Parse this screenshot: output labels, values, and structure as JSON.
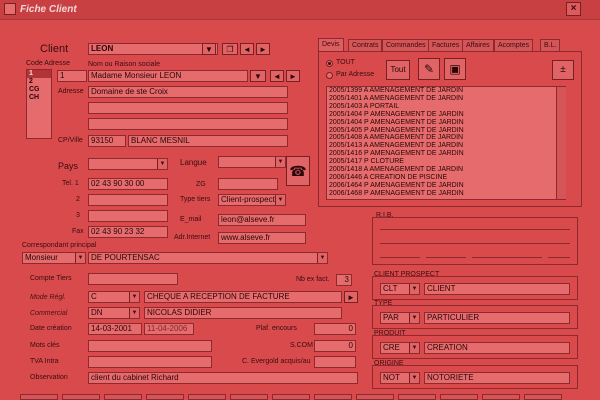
{
  "window": {
    "title": "Fiche Client",
    "close_glyph": "×"
  },
  "client": {
    "label": "Client",
    "code": "LEON",
    "code_adresse_label": "Code Adresse",
    "code_adresse_items": [
      "1",
      "2",
      "CG",
      "CH"
    ],
    "nom_label": "Nom ou Raison sociale",
    "num": "1",
    "nom": "Madame Monsieur LEON",
    "adresse_label": "Adresse",
    "adresse": "Domaine de ste Croix",
    "cp_ville_label": "CP/Ville",
    "cp": "93150",
    "ville": "BLANC MESNIL",
    "pays_label": "Pays",
    "langue_label": "Langue",
    "tel1_label": "Tel. 1",
    "tel1": "02 43 90 30 00",
    "zg_label": "ZG",
    "tel2_label": "2",
    "type_tiers_label": "Type tiers",
    "type_tiers": "Client-prospect",
    "tel3_label": "3",
    "email_label": "E_mail",
    "email": "leon@alseve.fr",
    "fax_label": "Fax",
    "fax": "02 43 90 23 32",
    "adr_internet_label": "Adr.Internet",
    "adr_internet": "www.alseve.fr"
  },
  "buttons": {
    "nav_down": "▼",
    "nav_prev": "◄",
    "nav_next": "►",
    "tout": "Tout",
    "wand": "✎",
    "print": "▣",
    "export": "±"
  },
  "tabs": [
    "Devis",
    "Contrats",
    "Commandes",
    "Factures",
    "Affaires",
    "Acomptes",
    "B.L."
  ],
  "devis": {
    "radio_tout": "TOUT",
    "radio_par_adresse": "Par Adresse",
    "items": [
      "2005/1399 A AMENAGEMENT DE JARDIN",
      "2005/1401 A AMENAGEMENT DE JARDIN",
      "2005/1403 A PORTAIL",
      "2005/1404 P AMENAGEMENT DE JARDIN",
      "2005/1404 P AMENAGEMENT DE JARDIN",
      "2005/1405 P AMENAGEMENT DE JARDIN",
      "2005/1408 A AMENAGEMENT DE JARDIN",
      "2005/1413 A AMENAGEMENT DE JARDIN",
      "2005/1416 P AMENAGEMENT DE JARDIN",
      "2005/1417 P CLOTURE",
      "2005/1418 A AMENAGEMENT DE JARDIN",
      "2006/1446 A CREATION DE PISCINE",
      "2006/1464 P AMENAGEMENT DE JARDIN",
      "2006/1468 P AMENAGEMENT DE JARDIN"
    ]
  },
  "correspondant": {
    "label": "Correspondant principal",
    "civilite": "Monsieur",
    "nom": "DE POURTENSAC"
  },
  "compte": {
    "compte_tiers_label": "Compte Tiers",
    "nb_ex_fact_label": "Nb ex fact.",
    "nb_ex_fact": "3",
    "mode_regl_label": "Mode Régl.",
    "mode_regl_code": "C",
    "mode_regl": "CHEQUE A RECEPTION DE FACTURE",
    "commercial_label": "Commercial",
    "commercial_code": "DN",
    "commercial": "NICOLAS DIDIER",
    "date_creation_label": "Date création",
    "date_creation": "14-03-2001",
    "date_modif": "11-04-2006",
    "plaf_encours_label": "Plaf. encours",
    "plaf_encours": "0",
    "mots_cles_label": "Mots clés",
    "scom_label": "S.COM",
    "scom": "0",
    "tva_label": "TVA Intra",
    "c_evergold_label": "C. Evergold acquis/au",
    "observation_label": "Observation",
    "observation": "client du cabinet Richard"
  },
  "right_panel": {
    "rib_label": "R.I.B.",
    "client_prospect_label": "CLIENT PROSPECT",
    "client_prospect_code": "CLT",
    "client_prospect": "CLIENT",
    "type_label": "TYPE",
    "type_code": "PAR",
    "type": "PARTICULIER",
    "produit_label": "PRODUIT",
    "produit_code": "CRE",
    "produit": "CREATION",
    "origine_label": "ORIGINE",
    "origine_code": "NOT",
    "origine": "NOTORIETE"
  }
}
